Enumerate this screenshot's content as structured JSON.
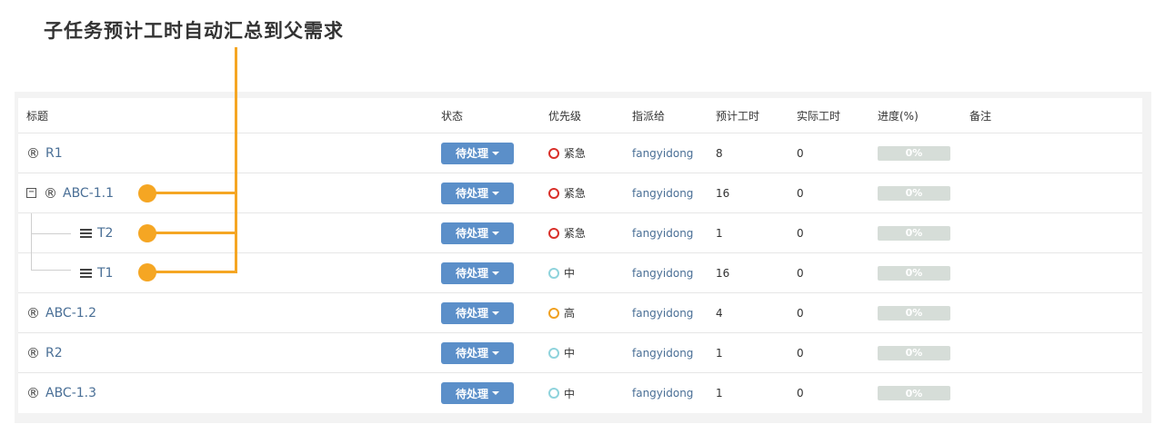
{
  "annotation": "子任务预计工时自动汇总到父需求",
  "columns": {
    "title": "标题",
    "status": "状态",
    "priority": "优先级",
    "assignee": "指派给",
    "estimated": "预计工时",
    "actual": "实际工时",
    "progress": "进度(%)",
    "note": "备注"
  },
  "colors": {
    "accent": "#f5a623",
    "button": "#5b8fc9",
    "link": "#4a6f96",
    "urgent": "#d9302a",
    "high": "#f0a020",
    "medium": "#8fd3dc",
    "progress_bg": "#d6ddd8"
  },
  "icons": {
    "requirement": "registered-icon",
    "task": "task-list-icon",
    "collapse": "collapse-minus-icon"
  },
  "rows": [
    {
      "title": "R1",
      "reg_symbol": "®",
      "status": "待处理",
      "priority": "紧急",
      "assignee": "fangyidong",
      "estimated": "8",
      "actual": "0",
      "progress": "0%",
      "progress_value": 0
    },
    {
      "title": "ABC-1.1",
      "reg_symbol": "®",
      "collapse_symbol": "−",
      "status": "待处理",
      "priority": "紧急",
      "assignee": "fangyidong",
      "estimated": "16",
      "actual": "0",
      "progress": "0%",
      "progress_value": 0
    },
    {
      "title": "T2",
      "status": "待处理",
      "priority": "紧急",
      "assignee": "fangyidong",
      "estimated": "1",
      "actual": "0",
      "progress": "0%",
      "progress_value": 0
    },
    {
      "title": "T1",
      "status": "待处理",
      "priority": "中",
      "assignee": "fangyidong",
      "estimated": "16",
      "actual": "0",
      "progress": "0%",
      "progress_value": 0
    },
    {
      "title": "ABC-1.2",
      "reg_symbol": "®",
      "status": "待处理",
      "priority": "高",
      "assignee": "fangyidong",
      "estimated": "4",
      "actual": "0",
      "progress": "0%",
      "progress_value": 0
    },
    {
      "title": "R2",
      "reg_symbol": "®",
      "status": "待处理",
      "priority": "中",
      "assignee": "fangyidong",
      "estimated": "1",
      "actual": "0",
      "progress": "0%",
      "progress_value": 0
    },
    {
      "title": "ABC-1.3",
      "reg_symbol": "®",
      "status": "待处理",
      "priority": "中",
      "assignee": "fangyidong",
      "estimated": "1",
      "actual": "0",
      "progress": "0%",
      "progress_value": 0
    }
  ]
}
